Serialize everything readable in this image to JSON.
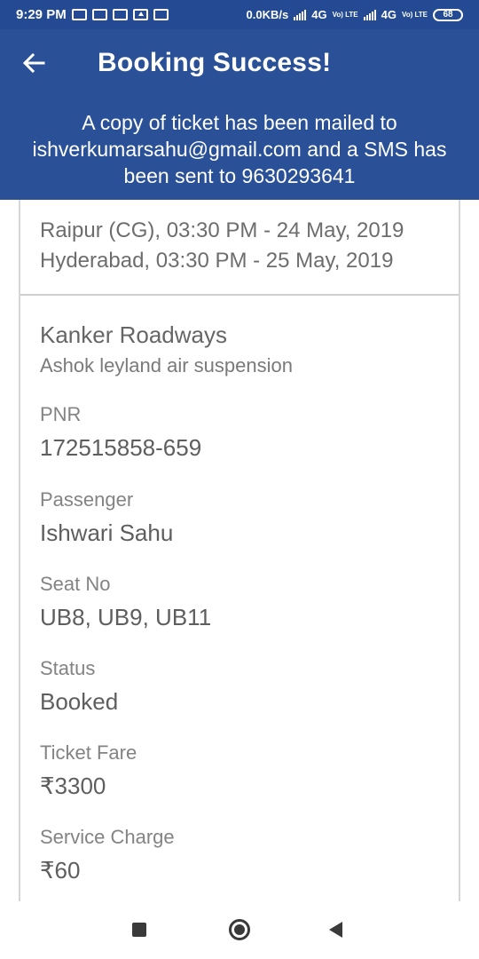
{
  "status_bar": {
    "time": "9:29 PM",
    "speed": "0.0KB/s",
    "net1": "4G",
    "net2": "4G",
    "lte1": "Vo) LTE",
    "lte2": "Vo) LTE",
    "battery": "68"
  },
  "header": {
    "title": "Booking Success!",
    "message": "A copy of ticket has been mailed to ishverkumarsahu@gmail.com and a SMS has been sent to 9630293641"
  },
  "journey": {
    "departure": "Raipur (CG), 03:30 PM - 24 May, 2019",
    "arrival": "Hyderabad, 03:30 PM - 25 May, 2019"
  },
  "operator": {
    "name": "Kanker Roadways",
    "bus_type": "Ashok leyland air suspension"
  },
  "details": [
    {
      "label": "PNR",
      "value": "172515858-659"
    },
    {
      "label": "Passenger",
      "value": "Ishwari Sahu"
    },
    {
      "label": "Seat No",
      "value": "UB8, UB9, UB11"
    },
    {
      "label": "Status",
      "value": "Booked"
    },
    {
      "label": "Ticket Fare",
      "value": "₹3300"
    },
    {
      "label": "Service Charge",
      "value": "₹60"
    }
  ],
  "colors": {
    "header_bg": "#2a5098",
    "status_bg": "#234a92"
  }
}
